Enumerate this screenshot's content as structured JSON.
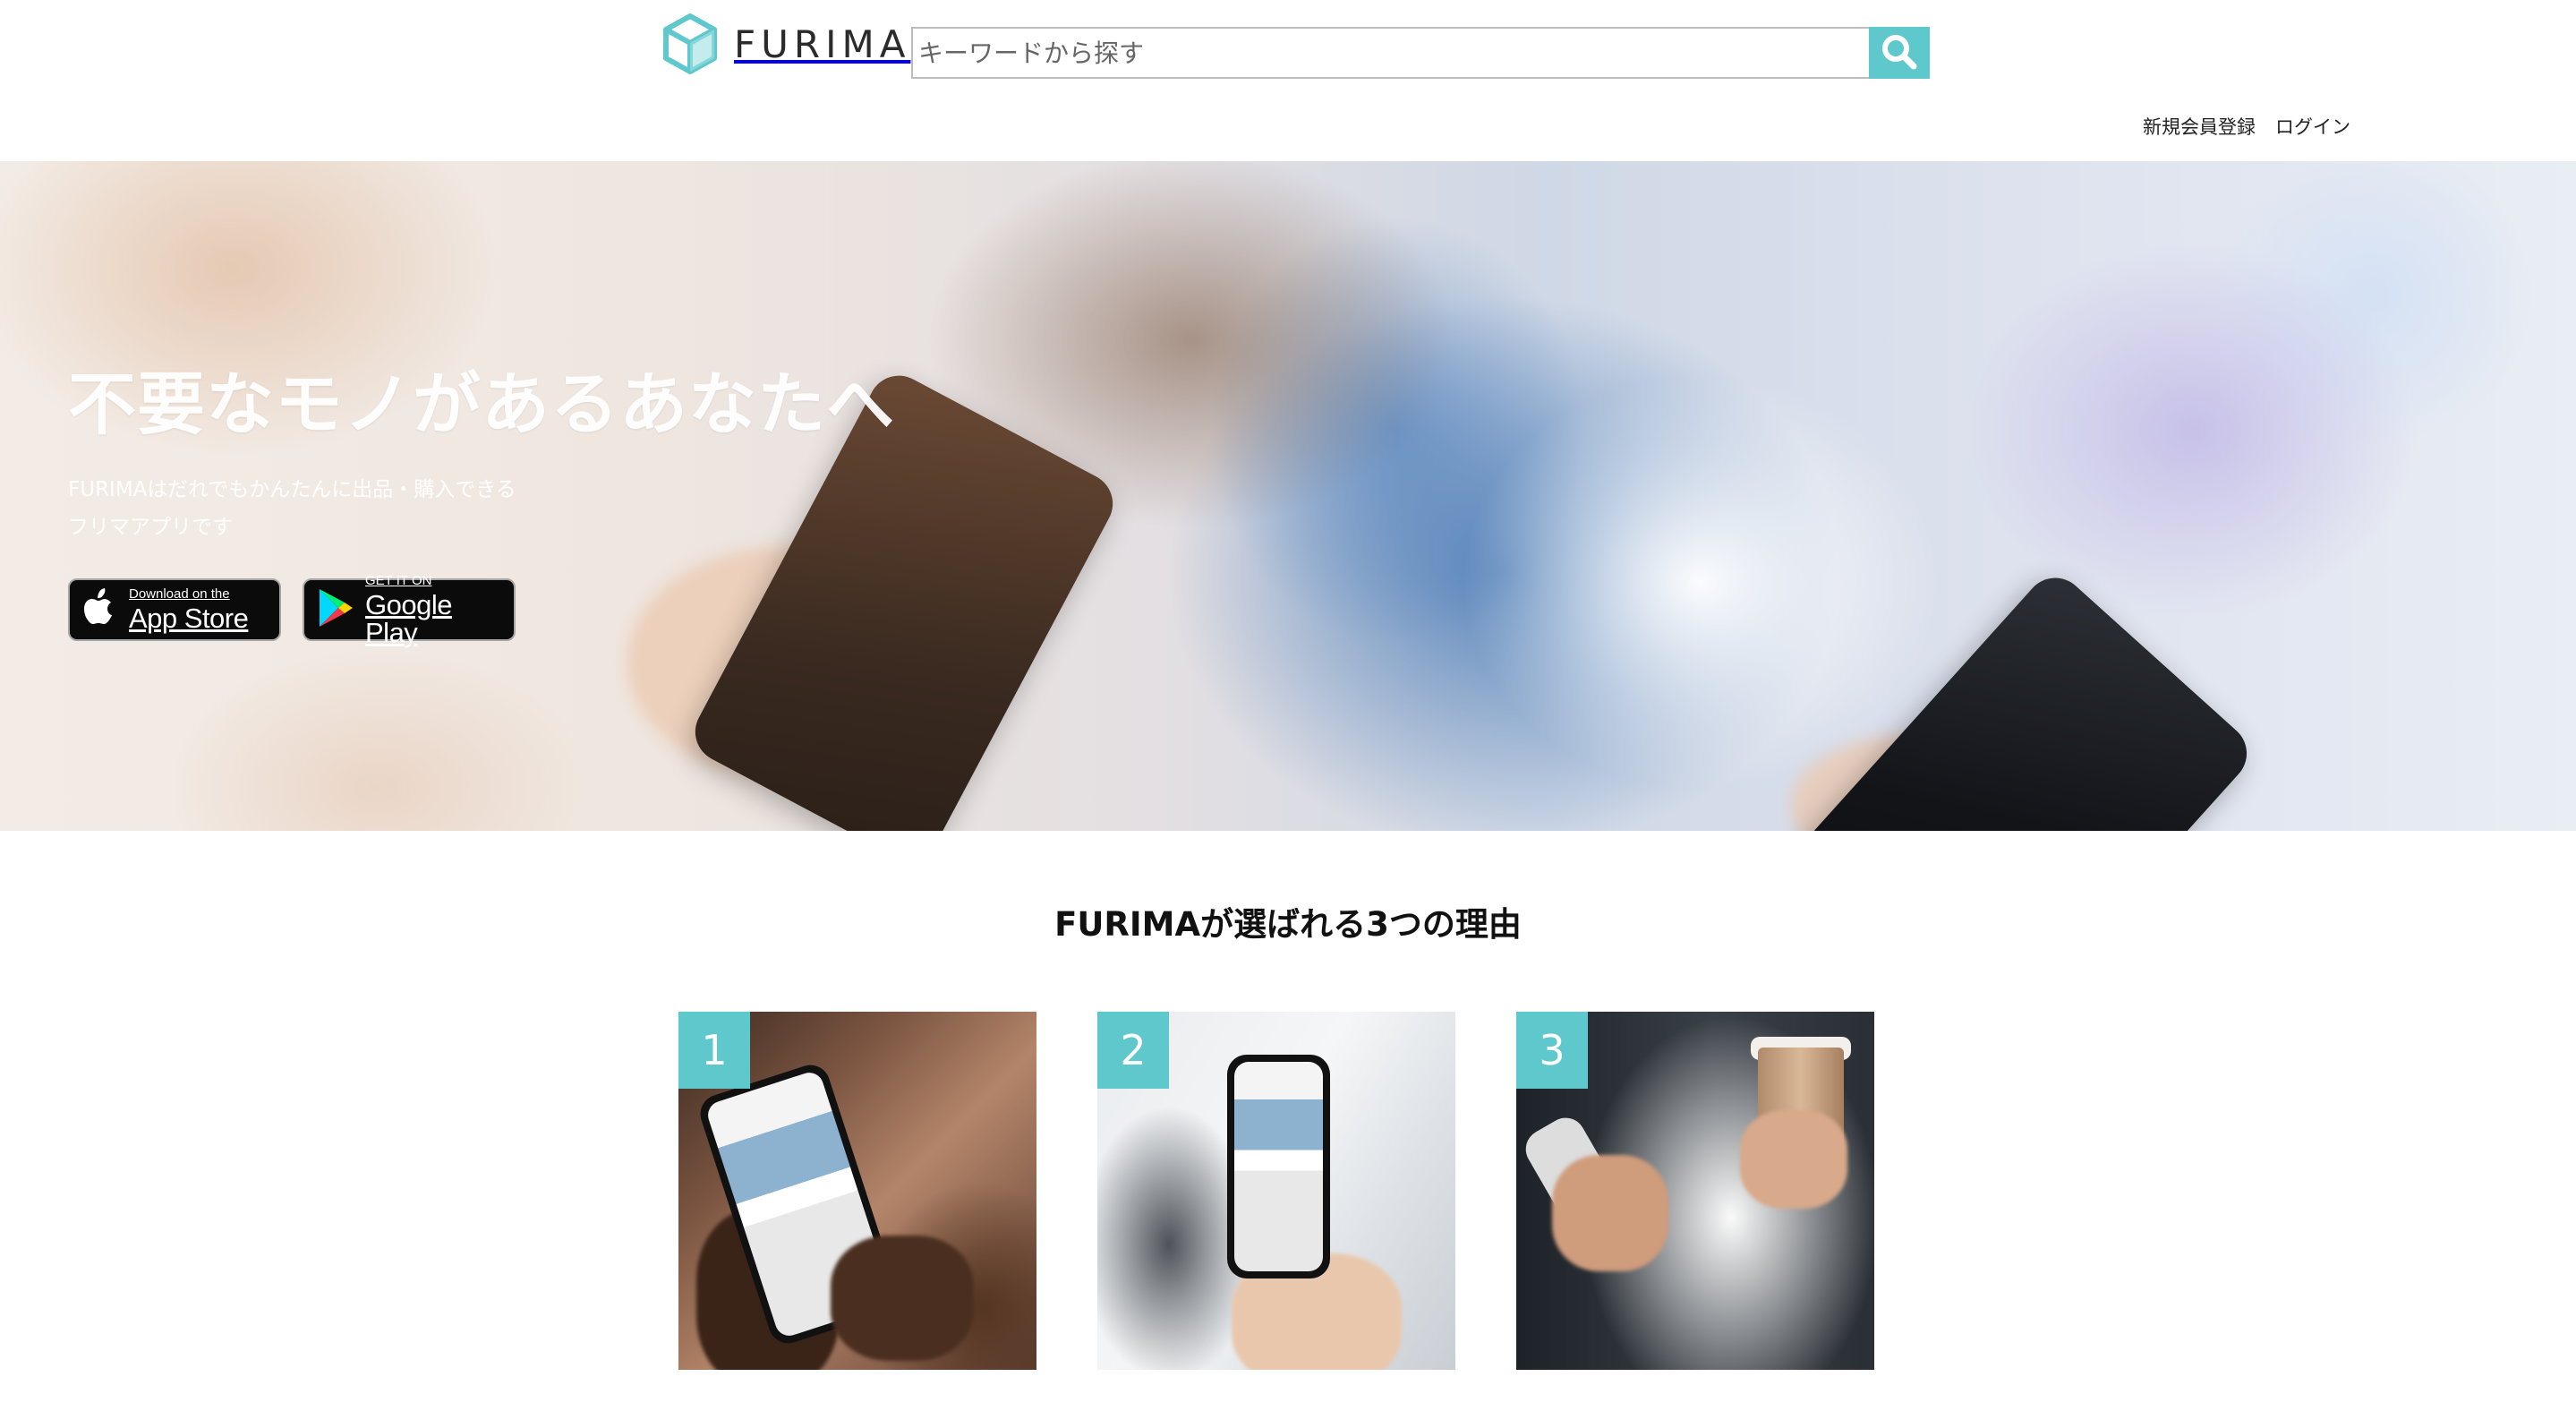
{
  "header": {
    "logo_text": "FURIMA",
    "search": {
      "placeholder": "キーワードから探す",
      "value": ""
    },
    "links": {
      "signup": "新規会員登録",
      "login": "ログイン"
    }
  },
  "hero": {
    "title": "不要なモノがあるあなたへ",
    "subtitle_line1": "FURIMAはだれでもかんたんに出品・購入できる",
    "subtitle_line2": "フリマアプリです",
    "app_store": {
      "small": "Download on the",
      "large": "App Store"
    },
    "google_play": {
      "small": "GET IT ON",
      "large": "Google Play"
    }
  },
  "reasons": {
    "title": "FURIMAが選ばれる3つの理由",
    "items": [
      {
        "number": "1",
        "icon": "phone-photo"
      },
      {
        "number": "2",
        "icon": "phone-photo"
      },
      {
        "number": "3",
        "icon": "phone-coffee-photo"
      }
    ]
  },
  "colors": {
    "accent": "#5fc8cc",
    "text": "#222222",
    "badge_bg": "#0b0b0b"
  }
}
